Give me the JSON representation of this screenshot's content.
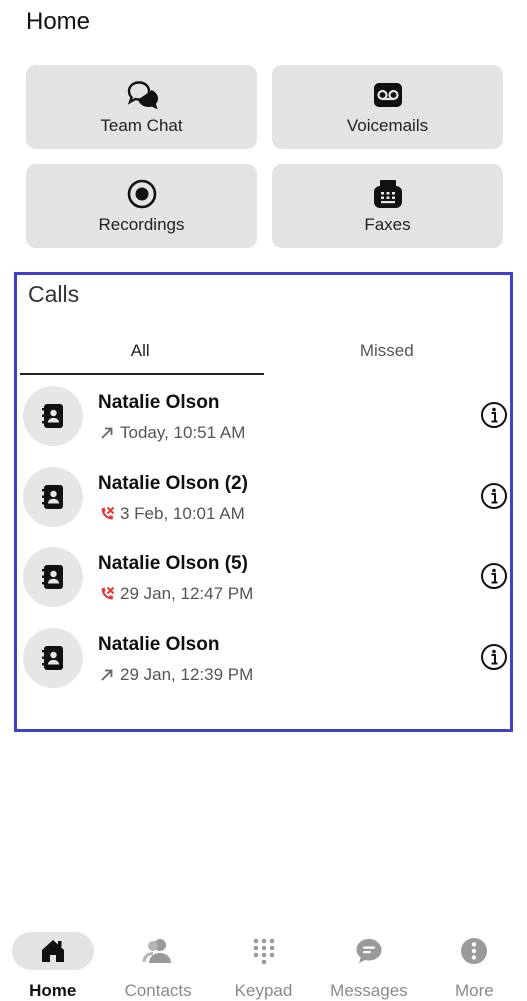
{
  "header": {
    "title": "Home"
  },
  "tiles": [
    {
      "label": "Team Chat",
      "icon": "team-chat-icon"
    },
    {
      "label": "Voicemails",
      "icon": "voicemail-icon"
    },
    {
      "label": "Recordings",
      "icon": "record-icon"
    },
    {
      "label": "Faxes",
      "icon": "fax-icon"
    }
  ],
  "calls": {
    "title": "Calls",
    "tabs": [
      {
        "label": "All",
        "active": true
      },
      {
        "label": "Missed",
        "active": false
      }
    ],
    "items": [
      {
        "name": "Natalie Olson",
        "time": "Today, 10:51 AM",
        "type": "outgoing"
      },
      {
        "name": "Natalie Olson (2)",
        "time": "3 Feb, 10:01 AM",
        "type": "missed"
      },
      {
        "name": "Natalie Olson (5)",
        "time": "29 Jan, 12:47 PM",
        "type": "missed"
      },
      {
        "name": "Natalie Olson",
        "time": "29 Jan, 12:39 PM",
        "type": "outgoing"
      }
    ]
  },
  "nav": [
    {
      "label": "Home",
      "icon": "home-icon",
      "active": true
    },
    {
      "label": "Contacts",
      "icon": "contacts-icon",
      "active": false
    },
    {
      "label": "Keypad",
      "icon": "keypad-icon",
      "active": false
    },
    {
      "label": "Messages",
      "icon": "messages-icon",
      "active": false
    },
    {
      "label": "More",
      "icon": "more-icon",
      "active": false
    }
  ],
  "colors": {
    "highlight_border": "#3f42c8",
    "missed_red": "#e53935",
    "tile_bg": "#e3e3e3"
  }
}
